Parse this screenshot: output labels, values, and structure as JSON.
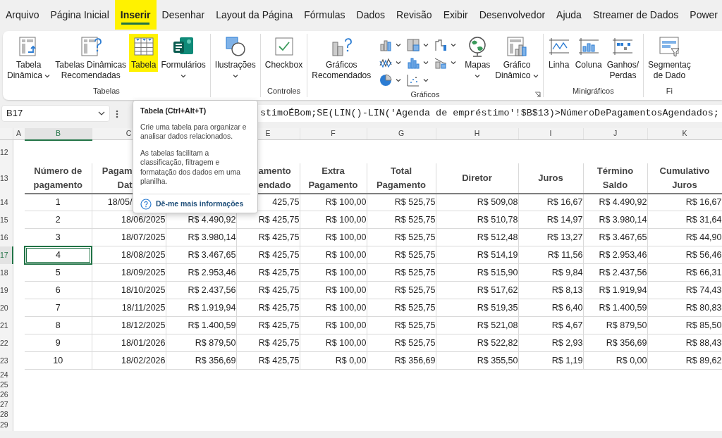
{
  "tabs": [
    {
      "label": "Arquivo",
      "selected": false,
      "highlighted": false
    },
    {
      "label": "Página Inicial",
      "selected": false,
      "highlighted": false
    },
    {
      "label": "Inserir",
      "selected": true,
      "highlighted": true
    },
    {
      "label": "Desenhar",
      "selected": false,
      "highlighted": false
    },
    {
      "label": "Layout da Página",
      "selected": false,
      "highlighted": false
    },
    {
      "label": "Fórmulas",
      "selected": false,
      "highlighted": false
    },
    {
      "label": "Dados",
      "selected": false,
      "highlighted": false
    },
    {
      "label": "Revisão",
      "selected": false,
      "highlighted": false
    },
    {
      "label": "Exibir",
      "selected": false,
      "highlighted": false
    },
    {
      "label": "Desenvolvedor",
      "selected": false,
      "highlighted": false
    },
    {
      "label": "Ajuda",
      "selected": false,
      "highlighted": false
    },
    {
      "label": "Streamer de Dados",
      "selected": false,
      "highlighted": false
    },
    {
      "label": "Power",
      "selected": false,
      "highlighted": false
    }
  ],
  "ribbon": {
    "groups": [
      {
        "label": "Tabelas",
        "dialog_launcher": false,
        "items": [
          {
            "kind": "large",
            "lines": [
              "Tabela",
              "Dinâmica"
            ],
            "dropdown": true,
            "highlighted": false
          },
          {
            "kind": "large",
            "lines": [
              "Tabelas Dinâmicas",
              "Recomendadas"
            ],
            "dropdown": false,
            "highlighted": false
          },
          {
            "kind": "large",
            "lines": [
              "Tabela"
            ],
            "dropdown": false,
            "highlighted": true
          },
          {
            "kind": "large",
            "lines": [
              "Formulários"
            ],
            "dropdown": true,
            "highlighted": false
          }
        ]
      },
      {
        "dialog_launcher": false,
        "items": [
          {
            "kind": "large",
            "lines": [
              "Ilustrações"
            ],
            "dropdown": true,
            "highlighted": false
          }
        ]
      },
      {
        "label": "Controles",
        "dialog_launcher": false,
        "items": [
          {
            "kind": "large",
            "lines": [
              "Checkbox"
            ],
            "dropdown": false,
            "highlighted": false
          }
        ]
      },
      {
        "label": "Gráficos",
        "dialog_launcher": true,
        "items": [
          {
            "kind": "large",
            "lines": [
              "Gráficos",
              "Recomendados"
            ],
            "dropdown": false,
            "highlighted": false
          },
          {
            "kind": "chart-grid"
          },
          {
            "kind": "large",
            "lines": [
              "Mapas"
            ],
            "dropdown": true,
            "highlighted": false
          },
          {
            "kind": "large",
            "lines": [
              "Gráfico",
              "Dinâmico"
            ],
            "dropdown": true,
            "highlighted": false
          }
        ]
      },
      {
        "label": "Minigráficos",
        "dialog_launcher": false,
        "items": [
          {
            "kind": "large",
            "lines": [
              "Linha"
            ],
            "dropdown": false,
            "highlighted": false
          },
          {
            "kind": "large",
            "lines": [
              "Coluna"
            ],
            "dropdown": false,
            "highlighted": false
          },
          {
            "kind": "large",
            "lines": [
              "Ganhos/",
              "Perdas"
            ],
            "dropdown": false,
            "highlighted": false
          }
        ]
      },
      {
        "label": "Fi",
        "dialog_launcher": false,
        "items": [
          {
            "kind": "large",
            "lines": [
              "Segmentaç",
              "de Dado"
            ],
            "dropdown": false,
            "highlighted": false
          }
        ]
      }
    ]
  },
  "formula_bar": {
    "name_box": "B17",
    "formula": "stimoÉBom;SE(LIN()-LIN('Agenda de empréstimo'!$B$13)>NúmeroDePagamentosAgendados;"
  },
  "sheet": {
    "column_letters": {
      "a": {
        "label": "A",
        "selected": false
      },
      "b": {
        "label": "B",
        "selected": true
      },
      "c": {
        "label": "C",
        "selected": false
      },
      "e": {
        "label": "E",
        "selected": false
      },
      "f": {
        "label": "F",
        "selected": false
      },
      "g": {
        "label": "G",
        "selected": false
      },
      "h": {
        "label": "H",
        "selected": false
      },
      "i": {
        "label": "I",
        "selected": false
      },
      "j": {
        "label": "J",
        "selected": false
      },
      "k": {
        "label": "K",
        "selected": false
      }
    },
    "row_numbers": [
      {
        "label": "12",
        "selected": false
      },
      {
        "label": "13",
        "selected": false
      },
      {
        "label": "14",
        "selected": false
      },
      {
        "label": "15",
        "selected": false
      },
      {
        "label": "16",
        "selected": false
      },
      {
        "label": "17",
        "selected": true
      },
      {
        "label": "18",
        "selected": false
      },
      {
        "label": "19",
        "selected": false
      },
      {
        "label": "20",
        "selected": false
      },
      {
        "label": "21",
        "selected": false
      },
      {
        "label": "22",
        "selected": false
      },
      {
        "label": "23",
        "selected": false
      },
      {
        "label": "24",
        "selected": false
      },
      {
        "label": "25",
        "selected": false
      },
      {
        "label": "26",
        "selected": false
      },
      {
        "label": "27",
        "selected": false
      },
      {
        "label": "28",
        "selected": false
      },
      {
        "label": "29",
        "selected": false
      }
    ],
    "table": {
      "header": {
        "b": [
          "Número de",
          "pagamento"
        ],
        "c": [
          "Pagam",
          "Dat"
        ],
        "e": [
          "amento",
          "endado"
        ],
        "f": [
          "Extra",
          "Pagamento"
        ],
        "g": [
          "Total",
          "Pagamento"
        ],
        "h": [
          "Diretor"
        ],
        "i": [
          "Juros"
        ],
        "j": [
          "Término",
          "Saldo"
        ],
        "k": [
          "Cumulativo",
          "Juros"
        ]
      },
      "rows": [
        {
          "selected": false,
          "b": "1",
          "c": "18/05/",
          "e": "425,75",
          "f": "R$ 100,00",
          "g": "R$ 525,75",
          "h": "R$ 509,08",
          "i": "R$ 16,67",
          "j": "R$ 4.490,92",
          "k": "R$ 16,67"
        },
        {
          "selected": false,
          "b": "2",
          "c": "18/06/2025",
          "d": "R$ 4.490,92",
          "e": "R$ 425,75",
          "f": "R$ 100,00",
          "g": "R$ 525,75",
          "h": "R$ 510,78",
          "i": "R$ 14,97",
          "j": "R$ 3.980,14",
          "k": "R$ 31,64"
        },
        {
          "selected": false,
          "b": "3",
          "c": "18/07/2025",
          "d": "R$ 3.980,14",
          "e": "R$ 425,75",
          "f": "R$ 100,00",
          "g": "R$ 525,75",
          "h": "R$ 512,48",
          "i": "R$ 13,27",
          "j": "R$ 3.467,65",
          "k": "R$ 44,90"
        },
        {
          "selected": true,
          "b": "4",
          "c": "18/08/2025",
          "d": "R$ 3.467,65",
          "e": "R$ 425,75",
          "f": "R$ 100,00",
          "g": "R$ 525,75",
          "h": "R$ 514,19",
          "i": "R$ 11,56",
          "j": "R$ 2.953,46",
          "k": "R$ 56,46"
        },
        {
          "selected": false,
          "b": "5",
          "c": "18/09/2025",
          "d": "R$ 2.953,46",
          "e": "R$ 425,75",
          "f": "R$ 100,00",
          "g": "R$ 525,75",
          "h": "R$ 515,90",
          "i": "R$ 9,84",
          "j": "R$ 2.437,56",
          "k": "R$ 66,31"
        },
        {
          "selected": false,
          "b": "6",
          "c": "18/10/2025",
          "d": "R$ 2.437,56",
          "e": "R$ 425,75",
          "f": "R$ 100,00",
          "g": "R$ 525,75",
          "h": "R$ 517,62",
          "i": "R$ 8,13",
          "j": "R$ 1.919,94",
          "k": "R$ 74,43"
        },
        {
          "selected": false,
          "b": "7",
          "c": "18/11/2025",
          "d": "R$ 1.919,94",
          "e": "R$ 425,75",
          "f": "R$ 100,00",
          "g": "R$ 525,75",
          "h": "R$ 519,35",
          "i": "R$ 6,40",
          "j": "R$ 1.400,59",
          "k": "R$ 80,83"
        },
        {
          "selected": false,
          "b": "8",
          "c": "18/12/2025",
          "d": "R$ 1.400,59",
          "e": "R$ 425,75",
          "f": "R$ 100,00",
          "g": "R$ 525,75",
          "h": "R$ 521,08",
          "i": "R$ 4,67",
          "j": "R$ 879,50",
          "k": "R$ 85,50"
        },
        {
          "selected": false,
          "b": "9",
          "c": "18/01/2026",
          "d": "R$ 879,50",
          "e": "R$ 425,75",
          "f": "R$ 100,00",
          "g": "R$ 525,75",
          "h": "R$ 522,82",
          "i": "R$ 2,93",
          "j": "R$ 356,69",
          "k": "R$ 88,43"
        },
        {
          "selected": false,
          "b": "10",
          "c": "18/02/2026",
          "d": "R$ 356,69",
          "e": "R$ 425,75",
          "f": "R$ 0,00",
          "g": "R$ 356,69",
          "h": "R$ 355,50",
          "i": "R$ 1,19",
          "j": "R$ 0,00",
          "k": "R$ 89,62"
        }
      ]
    }
  },
  "tooltip": {
    "title": "Tabela (Ctrl+Alt+T)",
    "paragraphs": [
      "Crie uma tabela para organizar e analisar dados relacionados.",
      "As tabelas facilitam a classificação, filtragem e formatação dos dados em uma planilha."
    ],
    "link": "Dê-me mais informações"
  }
}
